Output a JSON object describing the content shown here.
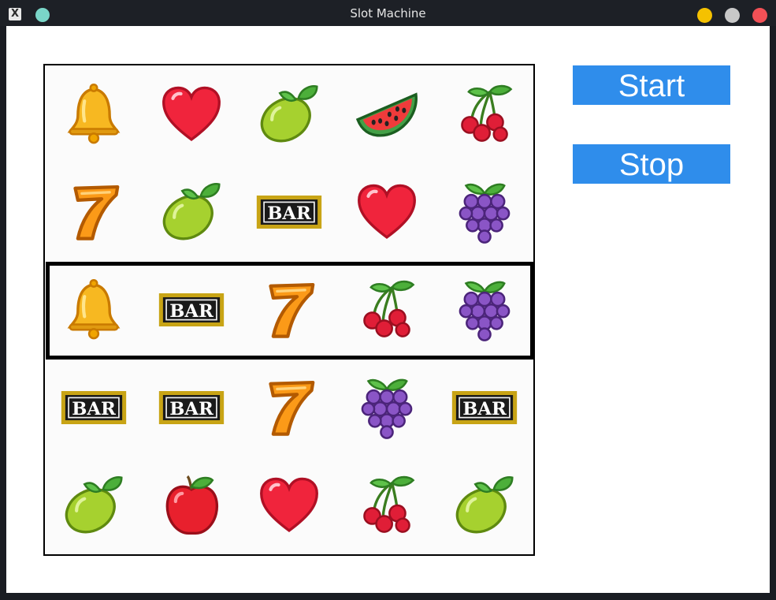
{
  "window": {
    "title": "Slot Machine",
    "app_icon_glyph": "X",
    "app_icon": "x11-icon",
    "controls": [
      "minimize",
      "maximize",
      "close"
    ]
  },
  "colors": {
    "title_bar": "#1d2026",
    "button_bg": "#2f8deb",
    "button_text": "#ffffff",
    "panel_border": "#000000"
  },
  "buttons": {
    "start_label": "Start",
    "stop_label": "Stop"
  },
  "reels": {
    "rows": [
      [
        "bell",
        "heart",
        "lime",
        "watermelon",
        "cherry"
      ],
      [
        "seven",
        "lime",
        "bar",
        "heart",
        "grapes"
      ],
      [
        "bell",
        "bar",
        "seven",
        "cherry",
        "grapes"
      ],
      [
        "bar",
        "bar",
        "seven",
        "grapes",
        "bar"
      ],
      [
        "lime",
        "apple",
        "heart",
        "cherry",
        "lime"
      ]
    ],
    "highlighted_row": 2,
    "bar_text": "BAR"
  }
}
